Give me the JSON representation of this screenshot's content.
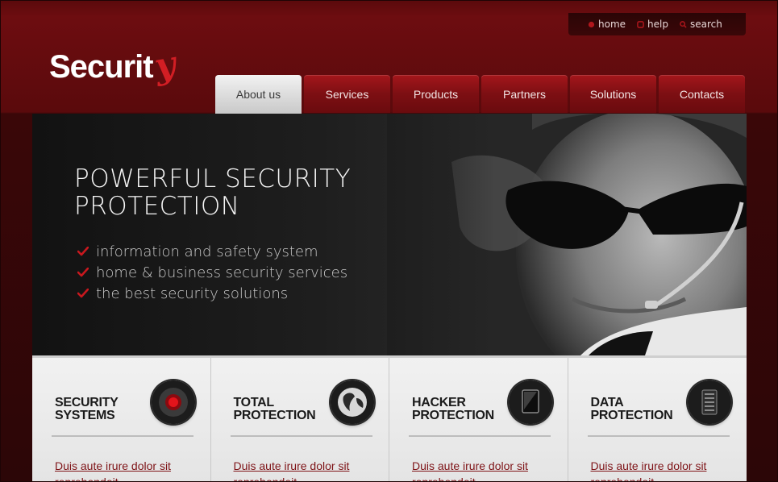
{
  "utility": {
    "items": [
      {
        "label": "home",
        "icon": "home-icon"
      },
      {
        "label": "help",
        "icon": "help-icon"
      },
      {
        "label": "search",
        "icon": "search-icon"
      }
    ]
  },
  "logo": {
    "main": "Securit",
    "accent": "y"
  },
  "nav": {
    "tabs": [
      {
        "label": "About us",
        "active": true
      },
      {
        "label": "Services"
      },
      {
        "label": "Products"
      },
      {
        "label": "Partners"
      },
      {
        "label": "Solutions"
      },
      {
        "label": "Contacts"
      }
    ]
  },
  "hero": {
    "title_line1": "POWERFUL SECURITY",
    "title_line2": "PROTECTION",
    "bullets": [
      "information and safety system",
      "home & business security services",
      "the best  security solutions"
    ]
  },
  "features": [
    {
      "title_line1": "SECURITY",
      "title_line2": "SYSTEMS",
      "icon": "alarm-button-icon",
      "link_line1": "Duis aute irure dolor sit",
      "link_line2": "reprehendeit"
    },
    {
      "title_line1": "TOTAL",
      "title_line2": "PROTECTION",
      "icon": "globe-icon",
      "link_line1": "Duis aute irure dolor sit",
      "link_line2": "reprehendeit"
    },
    {
      "title_line1": "HACKER",
      "title_line2": "PROTECTION",
      "icon": "monitor-icon",
      "link_line1": "Duis aute irure dolor sit",
      "link_line2": "reprehendeit"
    },
    {
      "title_line1": "DATA",
      "title_line2": "PROTECTION",
      "icon": "server-icon",
      "link_line1": "Duis aute irure dolor sit",
      "link_line2": "reprehendeit"
    }
  ],
  "colors": {
    "brand_red": "#d21e24",
    "link_red": "#7e1317",
    "nav_red": "#7d0f13"
  }
}
